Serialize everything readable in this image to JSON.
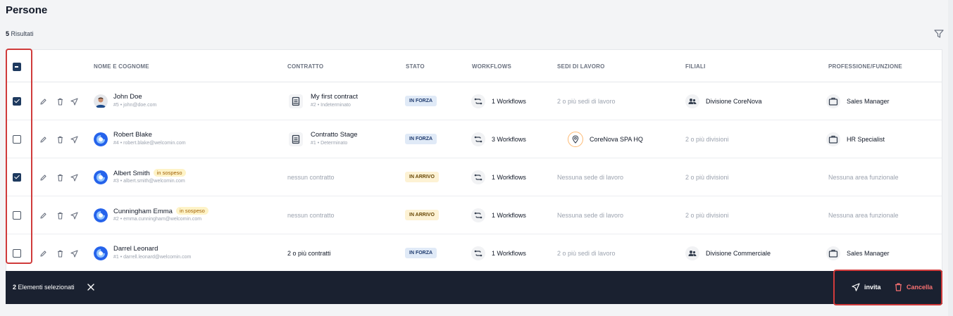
{
  "page": {
    "title": "Persone",
    "results_count": "5",
    "results_label": "Risultati"
  },
  "columns": {
    "name": "NOME E COGNOME",
    "contract": "CONTRATTO",
    "status": "STATO",
    "workflows": "WORKFLOWS",
    "sites": "SEDI DI LAVORO",
    "branches": "FILIALI",
    "profession": "PROFESSIONE/FUNZIONE"
  },
  "rows": [
    {
      "checked": true,
      "name": "John Doe",
      "pill": "",
      "sub": "#5 • john@doe.com",
      "contract_title": "My first contract",
      "contract_sub": "#2 • Indeterminato",
      "contract_text": "",
      "status": "IN FORZA",
      "status_type": "forza",
      "workflows": "1 Workflows",
      "site": "2 o più sedi di lavoro",
      "site_has_icon": false,
      "branch": "Divisione CoreNova",
      "branch_has_icon": true,
      "profession": "Sales Manager",
      "profession_has_icon": true
    },
    {
      "checked": false,
      "name": "Robert Blake",
      "pill": "",
      "sub": "#4 • robert.blake@welcomin.com",
      "contract_title": "Contratto Stage",
      "contract_sub": "#1 • Determinato",
      "contract_text": "",
      "status": "IN FORZA",
      "status_type": "forza",
      "workflows": "3 Workflows",
      "site": "CoreNova SPA HQ",
      "site_has_icon": true,
      "branch": "2 o più divisioni",
      "branch_has_icon": false,
      "profession": "HR Specialist",
      "profession_has_icon": true
    },
    {
      "checked": true,
      "name": "Albert Smith",
      "pill": "in sospeso",
      "sub": "#3 • albert.smith@welcomin.com",
      "contract_title": "",
      "contract_sub": "",
      "contract_text": "nessun contratto",
      "status": "IN ARRIVO",
      "status_type": "arrivo",
      "workflows": "1 Workflows",
      "site": "Nessuna sede di lavoro",
      "site_has_icon": false,
      "branch": "2 o più divisioni",
      "branch_has_icon": false,
      "profession": "Nessuna area funzionale",
      "profession_has_icon": false
    },
    {
      "checked": false,
      "name": "Cunningham Emma",
      "pill": "in sospeso",
      "sub": "#2 • emma.cunningham@welcomin.com",
      "contract_title": "",
      "contract_sub": "",
      "contract_text": "nessun contratto",
      "status": "IN ARRIVO",
      "status_type": "arrivo",
      "workflows": "1 Workflows",
      "site": "Nessuna sede di lavoro",
      "site_has_icon": false,
      "branch": "2 o più divisioni",
      "branch_has_icon": false,
      "profession": "Nessuna area funzionale",
      "profession_has_icon": false
    },
    {
      "checked": false,
      "name": "Darrel Leonard",
      "pill": "",
      "sub": "#1 • darrell.leonard@welcomin.com",
      "contract_title": "",
      "contract_sub": "",
      "contract_text": "2 o più contratti",
      "status": "IN FORZA",
      "status_type": "forza",
      "workflows": "1 Workflows",
      "site": "2 o più sedi di lavoro",
      "site_has_icon": false,
      "branch": "Divisione Commerciale",
      "branch_has_icon": true,
      "profession": "Sales Manager",
      "profession_has_icon": true
    }
  ],
  "selection_bar": {
    "count": "2",
    "label": "Elementi selezionati",
    "invite_label": "invita",
    "delete_label": "Cancella"
  },
  "colors": {
    "primary_dark": "#1a2130",
    "checkbox": "#1e3a5f",
    "danger": "#f87171",
    "highlight": "#d03b3b",
    "pending": "#fef3c7"
  },
  "icons": {
    "filter": "filter-icon",
    "edit": "pencil-icon",
    "delete": "trash-icon",
    "invite": "send-icon",
    "contract": "document-icon",
    "workflow": "workflow-icon",
    "site": "location-pin-icon",
    "branch": "group-icon",
    "profession": "briefcase-icon",
    "close": "close-icon"
  }
}
